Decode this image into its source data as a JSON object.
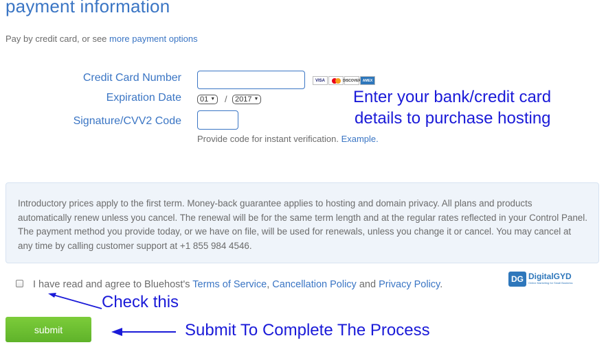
{
  "page": {
    "title": "payment information",
    "pay_prefix": "Pay by credit card, or see ",
    "pay_link": "more payment options"
  },
  "form": {
    "card_number_label": "Credit Card Number",
    "card_number_value": "",
    "expiration_label": "Expiration Date",
    "exp_month": "01",
    "exp_separator": "/",
    "exp_year": "2017",
    "cvv_label": "Signature/CVV2 Code",
    "cvv_value": "",
    "cvv_hint": "Provide code for instant verification. ",
    "cvv_hint_link": "Example.",
    "card_logos": [
      "VISA",
      "MasterCard",
      "DISCOVER",
      "AMEX"
    ]
  },
  "notice": {
    "text": "Introductory prices apply to the first term. Money-back guarantee applies to hosting and domain privacy. All plans and products automatically renew unless you cancel. The renewal will be for the same term length and at the regular rates reflected in your Control Panel. The payment method you provide today, or we have on file, will be used for renewals, unless you change it or cancel. You may cancel at any time by calling customer support at +1 855 984 4546."
  },
  "agreement": {
    "checked": false,
    "prefix": "I have read and agree to Bluehost's ",
    "tos": "Terms of Service",
    "sep1": ", ",
    "cancellation": "Cancellation Policy",
    "sep2": " and ",
    "privacy": "Privacy Policy",
    "suffix": "."
  },
  "submit": {
    "label": "submit"
  },
  "annotations": {
    "bank_line1": "Enter your bank/credit card",
    "bank_line2": "details to purchase hosting",
    "check": "Check this",
    "submit": "Submit To Complete The Process"
  },
  "brand": {
    "mark": "DG",
    "name": "DigitalGYD",
    "tagline": "Online Marketing for Small Business"
  },
  "colors": {
    "link": "#3a75c4",
    "annotation": "#1a1ad8",
    "submit_green": "#6cbf32",
    "notice_bg": "#eff4fa"
  }
}
